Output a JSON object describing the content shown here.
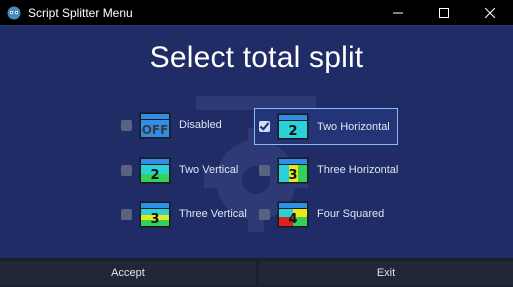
{
  "window": {
    "title": "Script Splitter Menu",
    "icon": "app-gear-icon"
  },
  "heading": "Select total split",
  "options": [
    {
      "label": "Disabled",
      "thumb_text": "OFF",
      "checked": false
    },
    {
      "label": "Two Horizontal",
      "thumb_text": "2",
      "checked": true
    },
    {
      "label": "Two Vertical",
      "thumb_text": "2",
      "checked": false
    },
    {
      "label": "Three Horizontal",
      "thumb_text": "3",
      "checked": false
    },
    {
      "label": "Three Vertical",
      "thumb_text": "3",
      "checked": false
    },
    {
      "label": "Four Squared",
      "thumb_text": "4",
      "checked": false
    }
  ],
  "buttons": {
    "accept": "Accept",
    "exit": "Exit"
  },
  "colors": {
    "background": "#1f2c66",
    "selection_border": "#8ab8ff",
    "titlebar": "#000000"
  }
}
